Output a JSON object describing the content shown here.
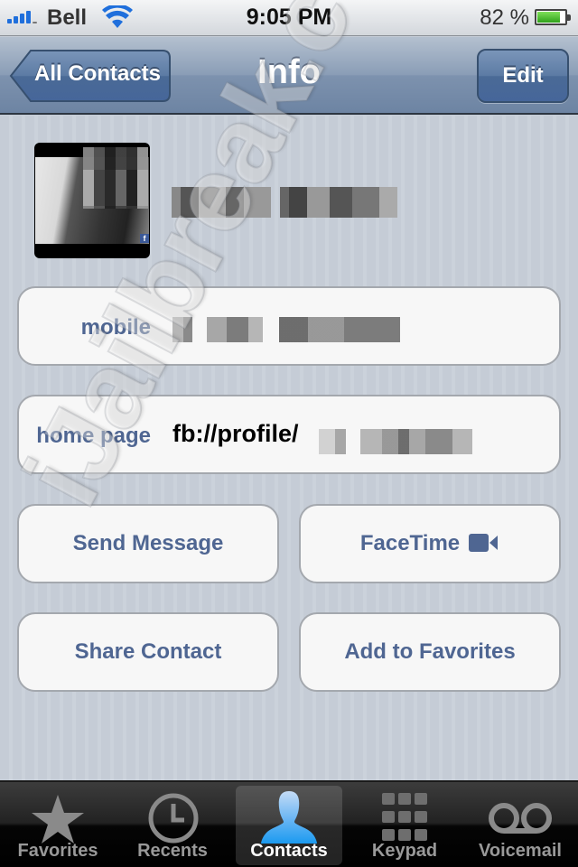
{
  "status_bar": {
    "carrier": "Bell",
    "time": "9:05 PM",
    "battery_percent_label": "82 %",
    "battery_level": 0.82,
    "signal_bars": 4,
    "icons": {
      "signal": "signal-bars-icon",
      "wifi": "wifi-icon",
      "battery": "battery-icon"
    }
  },
  "nav_bar": {
    "title": "Info",
    "back_label": "All Contacts",
    "edit_label": "Edit"
  },
  "contact": {
    "name": "[pixelated]",
    "photo_badge": "f",
    "fields": [
      {
        "label": "mobile",
        "value": "[pixelated]"
      },
      {
        "label": "home page",
        "value": "fb://profile/"
      }
    ]
  },
  "actions": {
    "send_message": "Send Message",
    "facetime": "FaceTime",
    "share_contact": "Share Contact",
    "add_to_favorites": "Add to Favorites"
  },
  "watermark": "iJailbreak.com",
  "tab_bar": {
    "active": "Contacts",
    "tabs": [
      {
        "label": "Favorites",
        "icon": "star-icon"
      },
      {
        "label": "Recents",
        "icon": "clock-icon"
      },
      {
        "label": "Contacts",
        "icon": "person-icon"
      },
      {
        "label": "Keypad",
        "icon": "keypad-icon"
      },
      {
        "label": "Voicemail",
        "icon": "voicemail-icon"
      }
    ]
  },
  "colors": {
    "label_blue": "#4f6692",
    "nav_blue": "#6d84a3",
    "battery_green": "#2ea11a",
    "contacts_tab_blue": "#3aa8f0"
  }
}
